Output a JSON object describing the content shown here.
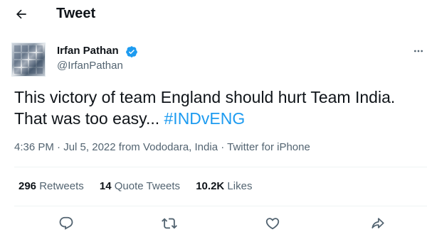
{
  "header": {
    "title": "Tweet"
  },
  "author": {
    "name": "Irfan Pathan",
    "handle": "@IrfanPathan"
  },
  "tweet": {
    "text_line1": "This victory of team England should hurt Team India.",
    "text_line2": "That was too easy... ",
    "hashtag": "#INDvENG"
  },
  "meta": {
    "time": "4:36 PM",
    "sep1": " · ",
    "date": "Jul 5, 2022",
    "location": " from Vododara, India",
    "sep2": " · ",
    "client": "Twitter for iPhone"
  },
  "stats": [
    {
      "count": "296",
      "label": "Retweets"
    },
    {
      "count": "14",
      "label": "Quote Tweets"
    },
    {
      "count": "10.2K",
      "label": "Likes"
    }
  ],
  "colors": {
    "accent": "#1d9bf0",
    "text": "#0f1419",
    "secondary": "#536471"
  },
  "icons": [
    "back-arrow-icon",
    "verified-badge-icon",
    "more-icon",
    "reply-icon",
    "retweet-icon",
    "like-icon",
    "share-icon"
  ]
}
